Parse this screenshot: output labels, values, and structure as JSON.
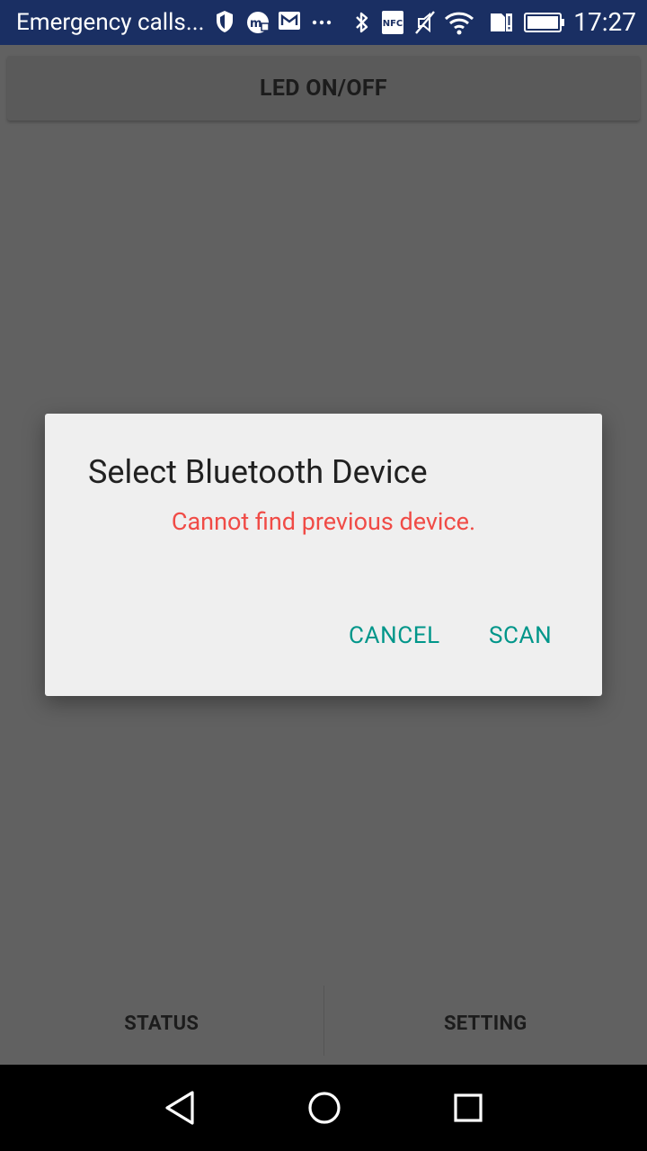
{
  "status_bar": {
    "notification_text": "Emergency calls...",
    "time": "17:27",
    "icons": [
      "shield-icon",
      "messenger-icon",
      "mail-icon",
      "more-dots-icon",
      "bluetooth-icon",
      "nfc-icon",
      "vibrate-icon",
      "wifi-icon",
      "sim-alert-icon",
      "battery-icon"
    ],
    "nfc_label": "NFC"
  },
  "app": {
    "led_button_label": "LED ON/OFF",
    "tabs": [
      {
        "label": "STATUS"
      },
      {
        "label": "SETTING"
      }
    ]
  },
  "dialog": {
    "title": "Select Bluetooth Device",
    "message": "Cannot find previous device.",
    "cancel_label": "CANCEL",
    "scan_label": "SCAN",
    "accent_color": "#00968a",
    "message_color": "#f04b46"
  },
  "nav_bar": {
    "buttons": [
      "back-icon",
      "home-icon",
      "recents-icon"
    ]
  }
}
